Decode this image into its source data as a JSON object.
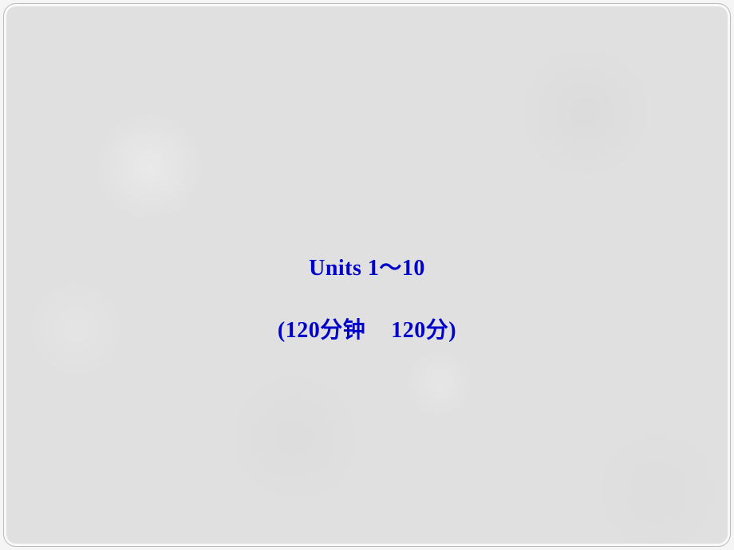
{
  "slide": {
    "title": "Units 1～10",
    "subtitle_left": "(120分钟",
    "subtitle_right": "120分)"
  }
}
